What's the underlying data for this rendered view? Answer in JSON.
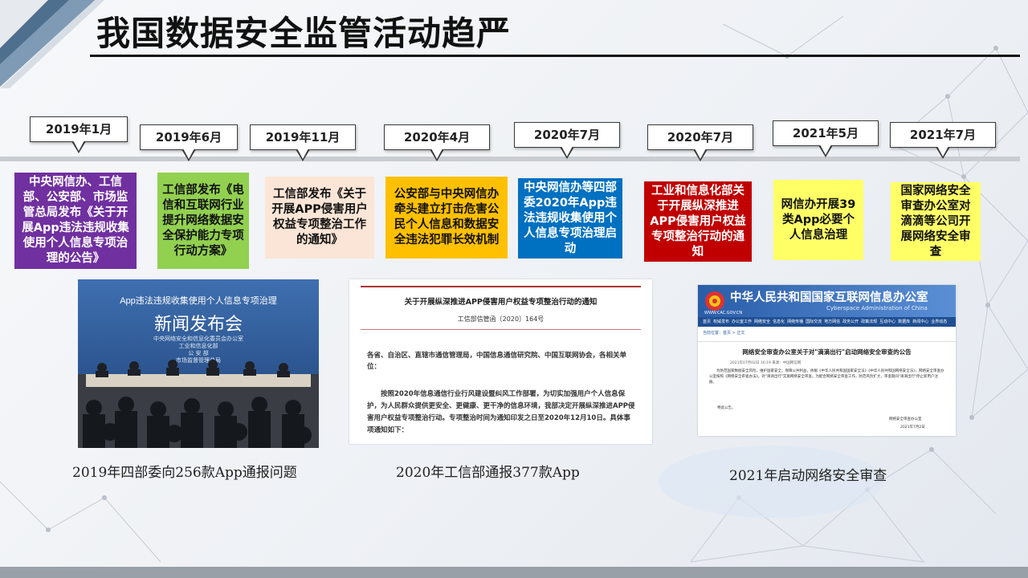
{
  "title": "我国数据安全监管活动趋严",
  "timeline": [
    {
      "date": "2019年1月",
      "text": "中央网信办、工信部、公安部、市场监管总局发布《关于开展App违法违规收集使用个人信息专项治理的公告》",
      "bg": "#7030a0",
      "fg": "#ffffff"
    },
    {
      "date": "2019年6月",
      "text": "工信部发布《电信和互联网行业提升网络数据安全保护能力专项行动方案》",
      "bg": "#92d050",
      "fg": "#111111"
    },
    {
      "date": "2019年11月",
      "text": "工信部发布《关于开展APP侵害用户权益专项整治工作的通知》",
      "bg": "#fbe5d6",
      "fg": "#111111"
    },
    {
      "date": "2020年4月",
      "text": "公安部与中央网信办牵头建立打击危害公民个人信息和数据安全违法犯罪长效机制",
      "bg": "#ffc000",
      "fg": "#111111"
    },
    {
      "date": "2020年7月",
      "text": "中央网信办等四部委2020年App违法违规收集使用个人信息专项治理启动",
      "bg": "#0070c0",
      "fg": "#ffffff"
    },
    {
      "date": "2020年7月",
      "text": "工业和信息化部关于开展纵深推进APP侵害用户权益专项整治行动的通知",
      "bg": "#c00000",
      "fg": "#ffffff"
    },
    {
      "date": "2021年5月",
      "text": "网信办开展39类App必要个人信息治理",
      "bg": "#ffff66",
      "fg": "#111111"
    },
    {
      "date": "2021年7月",
      "text": "国家网络安全审查办公室对滴滴等公司开展网络安全审查",
      "bg": "#ffff66",
      "fg": "#111111"
    }
  ],
  "photo1": {
    "banner_line1": "App违法违规收集使用个人信息专项治理",
    "banner_line2": "新闻发布会",
    "banner_line3": "中央网络安全和信息化委员会办公室",
    "banner_line4": "工业和信息化部",
    "banner_line5": "公 安 部",
    "banner_line6": "市场监督管理总局",
    "caption": "2019年四部委向256款App通报问题"
  },
  "photo2": {
    "doc_title": "关于开展纵深推进APP侵害用户权益专项整治行动的通知",
    "doc_number": "工信部信管函〔2020〕164号",
    "recipients": "各省、自治区、直辖市通信管理局，中国信息通信研究院、中国互联网协会，各相关单位：",
    "body": "按照2020年信息通信行业行风建设暨纠风工作部署，为切实加强用户个人信息保护，为人民群众提供更安全、更健康、更干净的信息环境，我部决定开展纵深推进APP侵害用户权益专项整治行动。专项整治时间为通知印发之日至2020年12月10日。具体事项通知如下：",
    "caption": "2020年工信部通报377款App"
  },
  "photo3": {
    "site_title": "中华人民共和国国家互联网信息办公室",
    "site_subtitle": "Cyberspace Administration of China",
    "url": "WWW.CAC.GOV.CN",
    "nav": [
      "首页",
      "权威发布",
      "办公室工作",
      "网络安全",
      "信息化",
      "网络传播",
      "国际交流",
      "地方网信",
      "政务公开",
      "政策法规",
      "互动中心",
      "数据库",
      "新闻中心",
      "业界动态"
    ],
    "breadcrumb": "当前位置：首页 > 正文",
    "article_title": "网络安全审查办公室关于对\"滴滴出行\"启动网络安全审查的公告",
    "article_meta": "2021年07月02日 16:19  来源：中国网信网",
    "paragraph": "为防范国家数据安全风险，维护国家安全，保障公共利益，依据《中华人民共和国国家安全法》《中华人民共和国网络安全法》，网络安全审查办公室按照《网络安全审查办法》，对\"滴滴出行\"实施网络安全审查。为配合网络安全审查工作，防范风险扩大，审查期间\"滴滴出行\"停止新用户注册。",
    "closing": "特此公告。",
    "signature": "网络安全审查办公室",
    "date": "2021年7月2日",
    "caption": "2021年启动网络安全审查"
  },
  "colors": {
    "title": "#111111",
    "timeline": "#c9ccd0",
    "accent_blue": "#2e6da4"
  }
}
